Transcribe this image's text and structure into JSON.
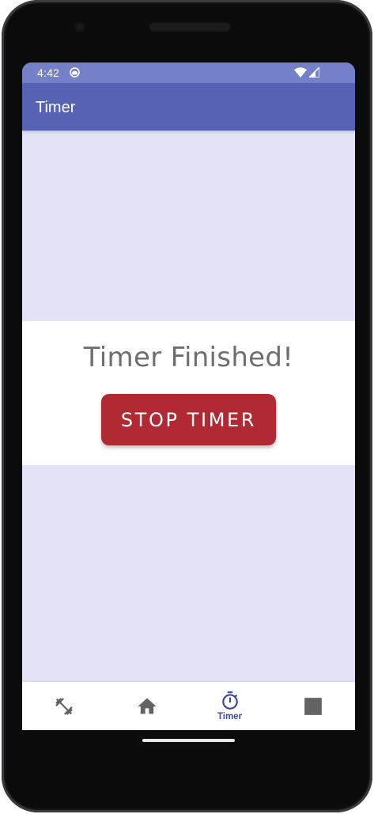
{
  "status_bar": {
    "time": "4:42",
    "notification_icon": "circle-notification-icon",
    "wifi_icon": "wifi-icon",
    "signal_icon": "cell-signal-icon",
    "color": "#7480c7"
  },
  "app_bar": {
    "title": "Timer",
    "color": "#5762b5"
  },
  "main": {
    "message": "Timer Finished!",
    "stop_button_label": "STOP TIMER",
    "button_color": "#b12a33",
    "background_color": "#e2e3f7"
  },
  "bottom_nav": {
    "items": [
      {
        "icon": "dumbbell-icon",
        "label": ""
      },
      {
        "icon": "home-icon",
        "label": ""
      },
      {
        "icon": "stopwatch-icon",
        "label": "Timer",
        "selected": true
      },
      {
        "icon": "stop-square-icon",
        "label": ""
      }
    ],
    "accent_color": "#3c46a0"
  }
}
